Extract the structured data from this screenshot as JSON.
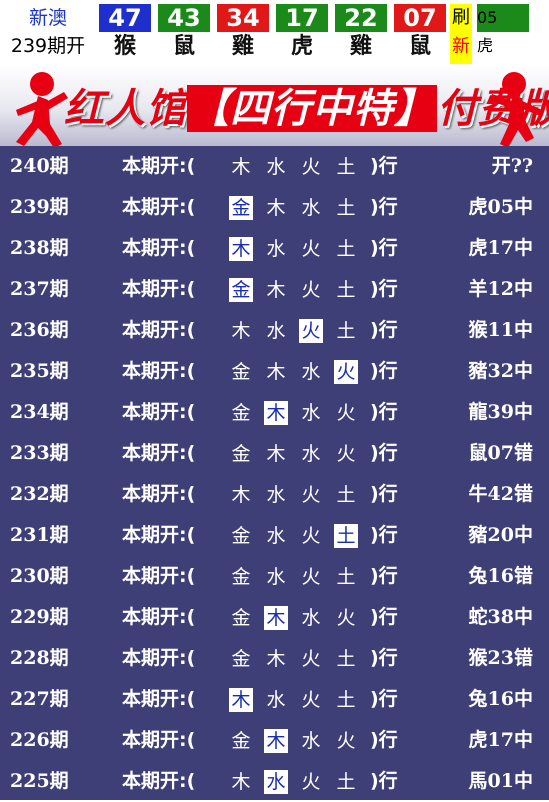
{
  "header": {
    "region": "新澳",
    "period": "239期开",
    "balls": [
      {
        "number": "47",
        "zodiac": "猴",
        "color": "#1f2fcc"
      },
      {
        "number": "43",
        "zodiac": "鼠",
        "color": "#1b8a1b"
      },
      {
        "number": "34",
        "zodiac": "雞",
        "color": "#e01818"
      },
      {
        "number": "17",
        "zodiac": "虎",
        "color": "#1b8a1b"
      },
      {
        "number": "22",
        "zodiac": "雞",
        "color": "#1b8a1b"
      },
      {
        "number": "07",
        "zodiac": "鼠",
        "color": "#e01818"
      }
    ],
    "refresh_top": "刷",
    "refresh_bottom": "新",
    "special": {
      "number": "05",
      "zodiac": "虎",
      "color": "#1b8a1b"
    }
  },
  "banner": {
    "title_prefix": "红人馆",
    "title_highlight": "【四行中特】",
    "title_suffix": "付费版"
  },
  "record_label": "本期开:(",
  "record_close": ")行",
  "records": [
    {
      "period": "240期",
      "elements": [
        "木",
        "水",
        "火",
        "土"
      ],
      "hit": -1,
      "result": "开??"
    },
    {
      "period": "239期",
      "elements": [
        "金",
        "木",
        "水",
        "土"
      ],
      "hit": 0,
      "result": "虎05中"
    },
    {
      "period": "238期",
      "elements": [
        "木",
        "水",
        "火",
        "土"
      ],
      "hit": 0,
      "result": "虎17中"
    },
    {
      "period": "237期",
      "elements": [
        "金",
        "木",
        "火",
        "土"
      ],
      "hit": 0,
      "result": "羊12中"
    },
    {
      "period": "236期",
      "elements": [
        "木",
        "水",
        "火",
        "土"
      ],
      "hit": 2,
      "result": "猴11中"
    },
    {
      "period": "235期",
      "elements": [
        "金",
        "木",
        "水",
        "火"
      ],
      "hit": 3,
      "result": "豬32中"
    },
    {
      "period": "234期",
      "elements": [
        "金",
        "木",
        "水",
        "火"
      ],
      "hit": 1,
      "result": "龍39中"
    },
    {
      "period": "233期",
      "elements": [
        "金",
        "木",
        "水",
        "火"
      ],
      "hit": -1,
      "result": "鼠07错"
    },
    {
      "period": "232期",
      "elements": [
        "木",
        "水",
        "火",
        "土"
      ],
      "hit": -1,
      "result": "牛42错"
    },
    {
      "period": "231期",
      "elements": [
        "金",
        "水",
        "火",
        "土"
      ],
      "hit": 3,
      "result": "豬20中"
    },
    {
      "period": "230期",
      "elements": [
        "金",
        "水",
        "火",
        "土"
      ],
      "hit": -1,
      "result": "兔16错"
    },
    {
      "period": "229期",
      "elements": [
        "金",
        "木",
        "水",
        "火"
      ],
      "hit": 1,
      "result": "蛇38中"
    },
    {
      "period": "228期",
      "elements": [
        "金",
        "木",
        "火",
        "土"
      ],
      "hit": -1,
      "result": "猴23错"
    },
    {
      "period": "227期",
      "elements": [
        "木",
        "水",
        "火",
        "土"
      ],
      "hit": 0,
      "result": "兔16中"
    },
    {
      "period": "226期",
      "elements": [
        "金",
        "木",
        "水",
        "火"
      ],
      "hit": 1,
      "result": "虎17中"
    },
    {
      "period": "225期",
      "elements": [
        "木",
        "水",
        "火",
        "土"
      ],
      "hit": 1,
      "result": "馬01中"
    }
  ]
}
